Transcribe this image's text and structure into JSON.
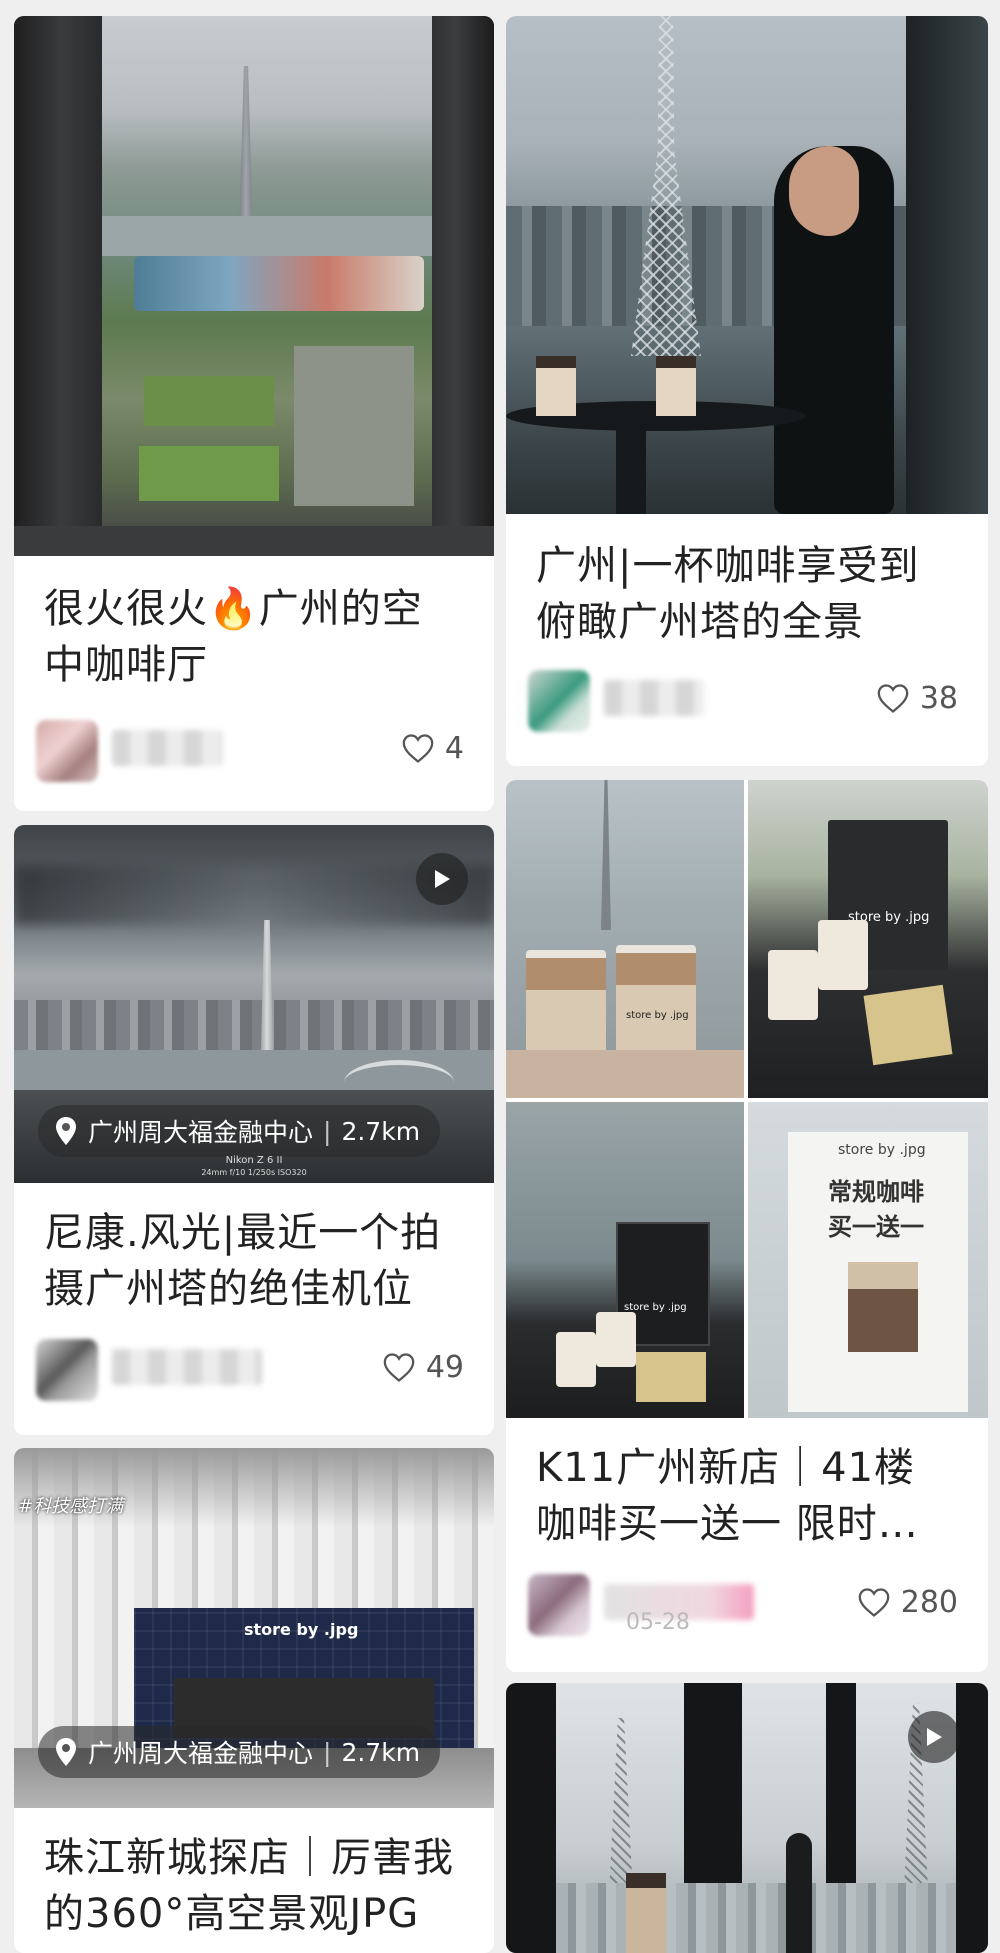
{
  "feed": {
    "left": [
      {
        "title_line1": "很火很火🔥广州的空",
        "title_line2": "中咖啡厅",
        "likes": "4"
      },
      {
        "title_line1": "尼康.风光|最近一个拍",
        "title_line2": "摄广州塔的绝佳机位",
        "likes": "49",
        "location": "广州周大福金融中心",
        "distance": "2.7km",
        "camera_caption": "Nikon Z 6 II",
        "camera_settings": "24mm f/10 1/250s ISO320"
      },
      {
        "title_line1": "珠江新城探店｜厉害我",
        "title_line2": "的360°高空景观JPG",
        "location": "广州周大福金融中心",
        "distance": "2.7km",
        "hashtag": "#科技感打满",
        "store_sign": "store by .jpg"
      }
    ],
    "right": [
      {
        "title_line1": "广州|一杯咖啡享受到",
        "title_line2": "俯瞰广州塔的全景",
        "likes": "38"
      },
      {
        "title_line1": "K11广州新店｜41楼",
        "title_line2": "咖啡买一送一 限时…",
        "likes": "280",
        "date": "05-28",
        "bag_text": "store by .jpg",
        "cup_text": "store by .jpg",
        "poster_brand": "store by .jpg",
        "poster_line1": "常规咖啡",
        "poster_line2": "买一送一"
      },
      {}
    ]
  },
  "colors": {
    "background": "#efefef",
    "card": "#ffffff",
    "title_text": "#222222",
    "meta_text": "#555555"
  },
  "icons": [
    "heart-icon",
    "location-pin-icon",
    "play-icon"
  ]
}
